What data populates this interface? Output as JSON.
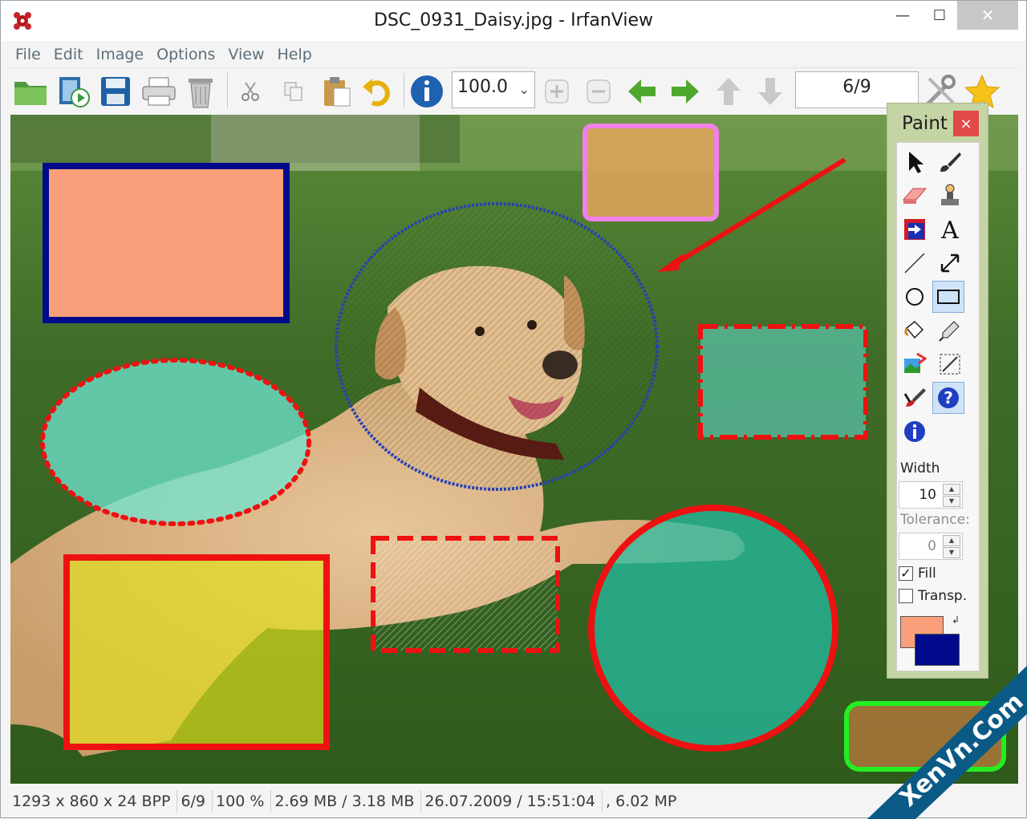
{
  "window": {
    "title": "DSC_0931_Daisy.jpg - IrfanView",
    "minimize": "—",
    "maximize": "☐",
    "close": "✕"
  },
  "menu": [
    "File",
    "Edit",
    "Image",
    "Options",
    "View",
    "Help"
  ],
  "toolbar": {
    "zoom_value": "100.0",
    "page_value": "6/9"
  },
  "paint": {
    "title": "Paint",
    "close": "×",
    "width_label": "Width",
    "width_value": "10",
    "tolerance_label": "Tolerance:",
    "tolerance_value": "0",
    "fill_label": "Fill",
    "fill_checked": true,
    "transp_label": "Transp.",
    "transp_checked": false,
    "fg_color": "#f9a07a",
    "bg_color": "#000a8a",
    "selected_tools": [
      "rectangle-tool",
      "help-tool"
    ]
  },
  "status": [
    "1293 x 860 x 24 BPP",
    "6/9",
    "100 %",
    "2.69 MB / 3.18 MB",
    "26.07.2009 / 15:51:04",
    ", 6.02 MP"
  ],
  "watermark": "XenVn.Com"
}
